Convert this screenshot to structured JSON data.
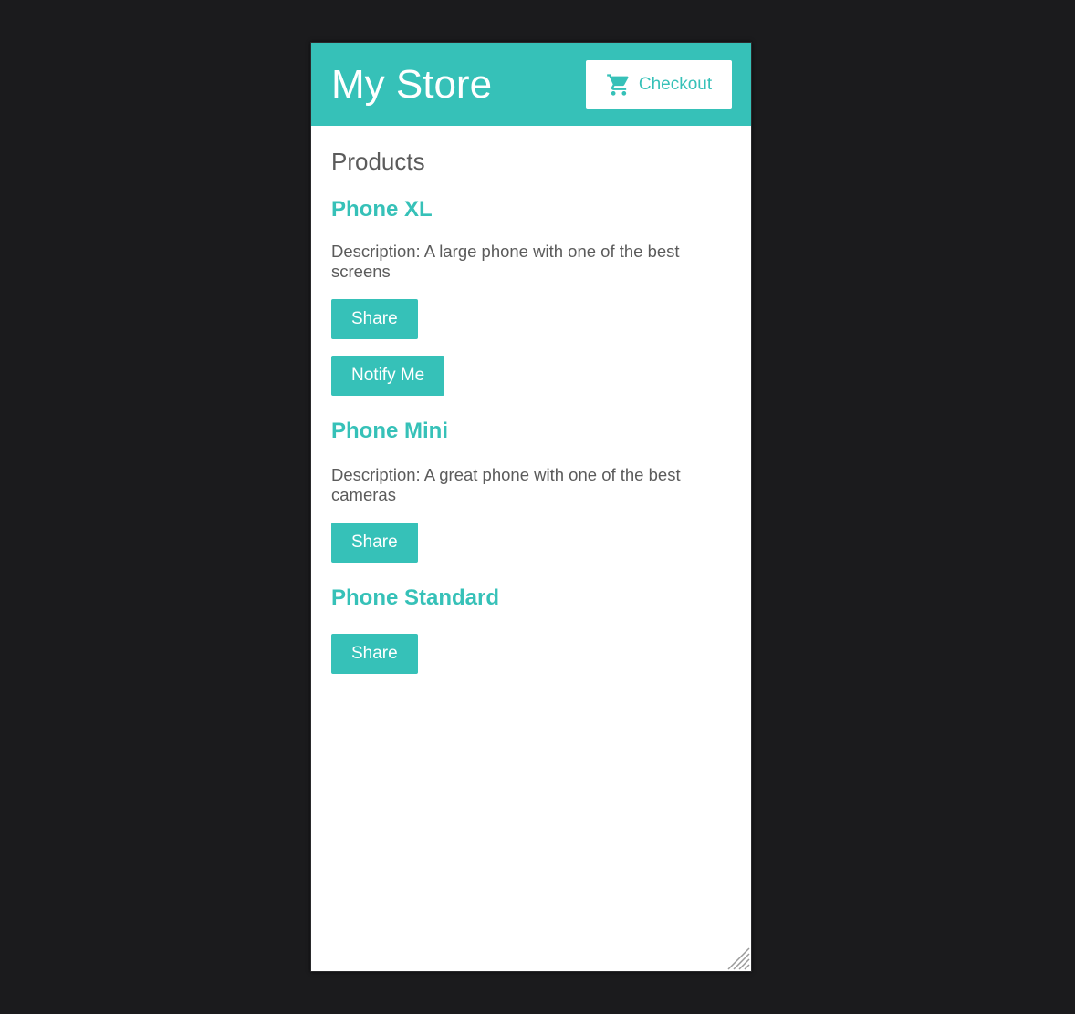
{
  "header": {
    "title": "My Store",
    "checkout_label": "Checkout",
    "checkout_icon": "cart-icon"
  },
  "main": {
    "section_title": "Products",
    "products": [
      {
        "name": "Phone XL",
        "description": "Description: A large phone with one of the best screens",
        "share_label": "Share",
        "notify_label": "Notify Me"
      },
      {
        "name": "Phone Mini",
        "description": "Description: A great phone with one of the best cameras",
        "share_label": "Share"
      },
      {
        "name": "Phone Standard",
        "share_label": "Share"
      }
    ]
  },
  "colors": {
    "accent": "#36c1b8",
    "text": "#5b5b5b",
    "background": "#1b1b1d"
  }
}
